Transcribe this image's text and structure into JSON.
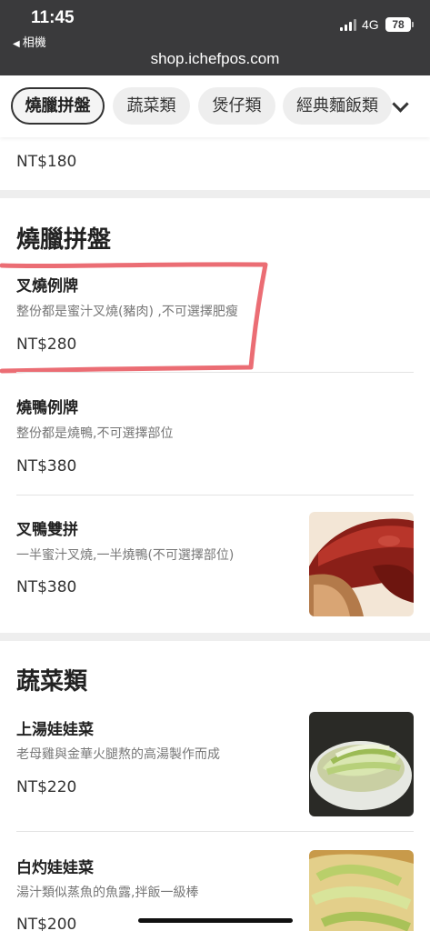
{
  "status_bar": {
    "time": "11:45",
    "back_app": "相機",
    "network": "4G",
    "battery": "78",
    "url": "shop.ichefpos.com"
  },
  "tabs": [
    {
      "label": "燒臘拼盤",
      "active": true
    },
    {
      "label": "蔬菜類",
      "active": false
    },
    {
      "label": "煲仔類",
      "active": false
    },
    {
      "label": "經典麵飯類",
      "active": false
    }
  ],
  "prev_item": {
    "price": "NT$180"
  },
  "sections": [
    {
      "title": "燒臘拼盤",
      "items": [
        {
          "name": "叉燒例牌",
          "description": "整份都是蜜汁叉燒(豬肉) ,不可選擇肥瘦",
          "price": "NT$280",
          "highlighted": true
        },
        {
          "name": "燒鴨例牌",
          "description": "整份都是燒鴨,不可選擇部位",
          "price": "NT$380"
        },
        {
          "name": "叉鴨雙拼",
          "description": "一半蜜汁叉燒,一半燒鴨(不可選擇部位)",
          "price": "NT$380",
          "image": "roast-duck-pork-photo"
        }
      ]
    },
    {
      "title": "蔬菜類",
      "items": [
        {
          "name": "上湯娃娃菜",
          "description": "老母雞與金華火腿熬的高湯製作而成",
          "price": "NT$220",
          "image": "baby-cabbage-soup-photo"
        },
        {
          "name": "白灼娃娃菜",
          "description": "湯汁類似蒸魚的魚露,拌飯一級棒",
          "price": "NT$200",
          "image": "blanched-cabbage-photo"
        }
      ]
    }
  ],
  "colors": {
    "header_bg": "#3a3a3c",
    "annotation": "#e8545c",
    "section_gap": "#eeeeee"
  }
}
